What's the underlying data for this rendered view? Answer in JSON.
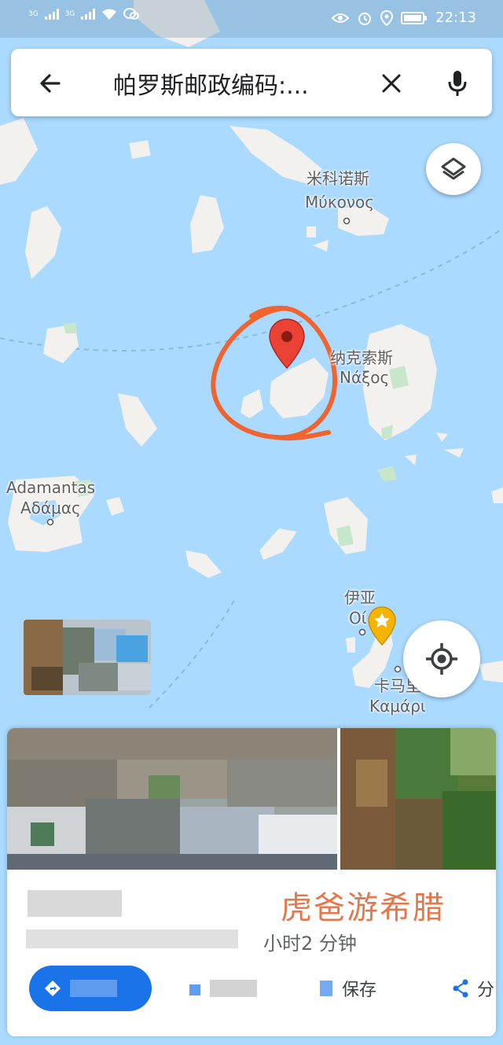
{
  "status_bar": {
    "net1": "3G",
    "net2": "3G",
    "time": "22:13"
  },
  "search": {
    "query": "帕罗斯邮政编码:..."
  },
  "map_labels": {
    "mykonos_cn": "米科诺斯",
    "mykonos_gr": "Μύκονος",
    "naxos_cn": "纳克索斯",
    "naxos_gr": "Νάξος",
    "adamantas_en": "Adamantas",
    "adamantas_gr": "Αδάμας",
    "oia_cn": "伊亚",
    "oia_gr": "Οί",
    "kamari_cn": "卡马里",
    "kamari_gr": "Καμάρι"
  },
  "card": {
    "watermark": "虎爸游希腊",
    "subtitle_visible": "小时2 分钟",
    "chip_share": "分",
    "chip_save": "保存"
  },
  "colors": {
    "water": "#aadaff",
    "land": "#f2f1ee",
    "park": "#c8e6c9",
    "pin": "#ea4335",
    "annotation": "#f06430",
    "primary": "#1a73e8",
    "watermark": "#e3784f"
  }
}
